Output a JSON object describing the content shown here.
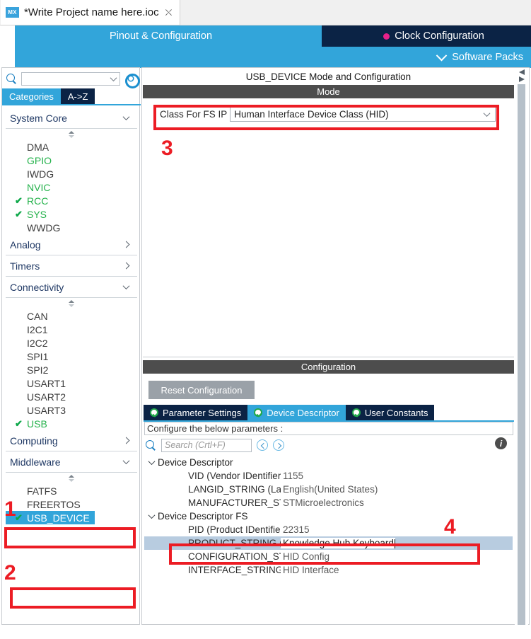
{
  "window": {
    "file_tab": {
      "logo": "MX",
      "title": "*Write Project name here.ioc",
      "close_icon": "close-icon"
    }
  },
  "ribbon": {
    "pinout_tab": "Pinout & Configuration",
    "clock_tab": "Clock Configuration",
    "software_packs": "Software Packs"
  },
  "sidebar": {
    "search_placeholder": "",
    "gear_icon": "gear-icon",
    "tabs": [
      {
        "label": "Categories",
        "active": true
      },
      {
        "label": "A->Z",
        "active": false
      }
    ],
    "categories": [
      {
        "name": "System Core",
        "expanded": true,
        "items": [
          {
            "label": "DMA",
            "state": "normal",
            "checked": false
          },
          {
            "label": "GPIO",
            "state": "green",
            "checked": false
          },
          {
            "label": "IWDG",
            "state": "normal",
            "checked": false
          },
          {
            "label": "NVIC",
            "state": "green",
            "checked": false
          },
          {
            "label": "RCC",
            "state": "green",
            "checked": true
          },
          {
            "label": "SYS",
            "state": "green",
            "checked": true
          },
          {
            "label": "WWDG",
            "state": "normal",
            "checked": false
          }
        ]
      },
      {
        "name": "Analog",
        "expanded": false,
        "items": []
      },
      {
        "name": "Timers",
        "expanded": false,
        "items": []
      },
      {
        "name": "Connectivity",
        "expanded": true,
        "items": [
          {
            "label": "CAN",
            "state": "normal",
            "checked": false
          },
          {
            "label": "I2C1",
            "state": "normal",
            "checked": false
          },
          {
            "label": "I2C2",
            "state": "normal",
            "checked": false
          },
          {
            "label": "SPI1",
            "state": "normal",
            "checked": false
          },
          {
            "label": "SPI2",
            "state": "normal",
            "checked": false
          },
          {
            "label": "USART1",
            "state": "normal",
            "checked": false
          },
          {
            "label": "USART2",
            "state": "normal",
            "checked": false
          },
          {
            "label": "USART3",
            "state": "normal",
            "checked": false
          },
          {
            "label": "USB",
            "state": "green",
            "checked": true
          }
        ]
      },
      {
        "name": "Computing",
        "expanded": false,
        "items": []
      },
      {
        "name": "Middleware",
        "expanded": true,
        "items": [
          {
            "label": "FATFS",
            "state": "normal",
            "checked": false
          },
          {
            "label": "FREERTOS",
            "state": "normal",
            "checked": false
          },
          {
            "label": "USB_DEVICE",
            "state": "selected",
            "checked": true
          }
        ]
      }
    ]
  },
  "main": {
    "panel_title": "USB_DEVICE Mode and Configuration",
    "mode": {
      "header": "Mode",
      "class_label": "Class For FS IP",
      "class_value": "Human Interface Device Class (HID)"
    },
    "configuration": {
      "header": "Configuration",
      "reset_button": "Reset Configuration",
      "tabs": [
        {
          "label": "Parameter Settings",
          "active": false
        },
        {
          "label": "Device Descriptor",
          "active": true
        },
        {
          "label": "User Constants",
          "active": false
        }
      ],
      "subtitle": "Configure the below parameters :",
      "search_placeholder": "Search (Crtl+F)",
      "info_icon": "info-icon",
      "tree": [
        {
          "group": "Device Descriptor",
          "rows": [
            {
              "name": "VID (Vendor IDentifier)",
              "value": "1155",
              "selected": false
            },
            {
              "name": "LANGID_STRING (Language Id...",
              "value": "English(United States)",
              "selected": false
            },
            {
              "name": "MANUFACTURER_STRING (M...",
              "value": "STMicroelectronics",
              "selected": false
            }
          ]
        },
        {
          "group": "Device Descriptor FS",
          "rows": [
            {
              "name": "PID (Product IDentifier)",
              "value": "22315",
              "selected": false
            },
            {
              "name": "PRODUCT_STRING (Product I...",
              "value": "Knowledge Hub Keyboard",
              "selected": true
            },
            {
              "name": "CONFIGURATION_STRING (C...",
              "value": "HID Config",
              "selected": false
            },
            {
              "name": "INTERFACE_STRING (Interfac...",
              "value": "HID Interface",
              "selected": false
            }
          ]
        }
      ]
    }
  },
  "annotations": {
    "numbers": [
      "1",
      "2",
      "3",
      "4"
    ],
    "color": "#ec1c24"
  }
}
